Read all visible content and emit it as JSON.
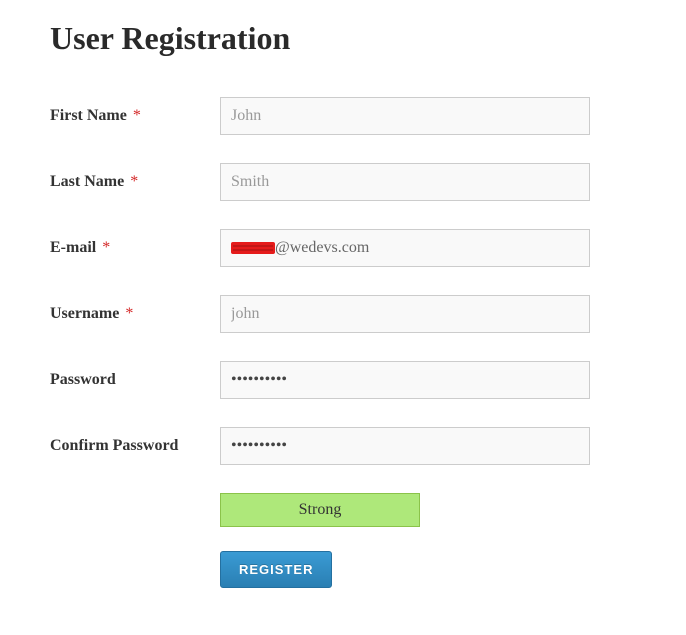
{
  "page": {
    "title": "User Registration"
  },
  "form": {
    "first_name": {
      "label": "First Name",
      "required": true,
      "placeholder": "John",
      "value": ""
    },
    "last_name": {
      "label": "Last Name",
      "required": true,
      "placeholder": "Smith",
      "value": ""
    },
    "email": {
      "label": "E-mail",
      "required": true,
      "redacted_prefix": true,
      "domain_part": "@wedevs.com"
    },
    "username": {
      "label": "Username",
      "required": true,
      "placeholder": "john",
      "value": ""
    },
    "password": {
      "label": "Password",
      "required": false,
      "value": "••••••••••"
    },
    "confirm_password": {
      "label": "Confirm Password",
      "required": false,
      "value": "••••••••••"
    },
    "strength": {
      "label": "Strong"
    },
    "submit": {
      "label": "REGISTER"
    },
    "required_marker": "*"
  }
}
